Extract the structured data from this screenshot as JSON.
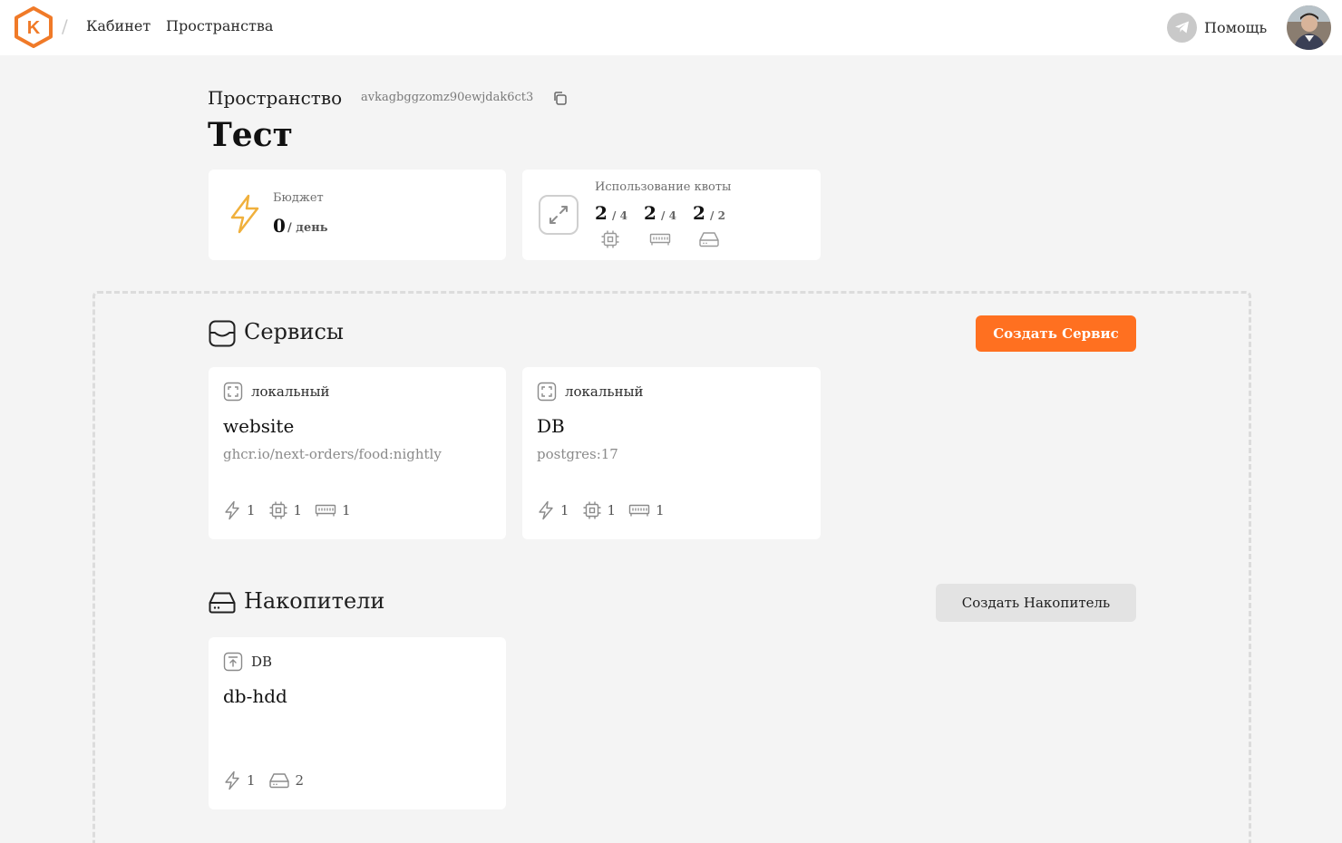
{
  "topbar": {
    "logo_icon": "kubik-hexagon-logo",
    "logo_letter": "K",
    "separator": "/",
    "breadcrumbs": [
      "Кабинет",
      "Пространства"
    ],
    "help_label": "Помощь",
    "help_icon": "telegram-icon"
  },
  "header": {
    "space_label": "Пространство",
    "space_id": "avkagbggzomz90ewjdak6ct3",
    "title": "Тест"
  },
  "budget": {
    "label": "Бюджет",
    "value": "0",
    "unit": "/ день",
    "icon": "lightning-icon"
  },
  "quota": {
    "label": "Использование квоты",
    "items": [
      {
        "used": "2",
        "total": "/ 4",
        "icon": "cpu-icon"
      },
      {
        "used": "2",
        "total": "/ 4",
        "icon": "memory-icon"
      },
      {
        "used": "2",
        "total": "/ 2",
        "icon": "disk-icon"
      }
    ]
  },
  "services": {
    "title": "Сервисы",
    "create_label": "Создать Сервис",
    "items": [
      {
        "tag": "локальный",
        "name": "website",
        "image": "ghcr.io/next-orders/food:nightly",
        "power": "1",
        "cpu": "1",
        "ram": "1"
      },
      {
        "tag": "локальный",
        "name": "DB",
        "image": "postgres:17",
        "power": "1",
        "cpu": "1",
        "ram": "1"
      }
    ]
  },
  "storages": {
    "title": "Накопители",
    "create_label": "Создать Накопитель",
    "items": [
      {
        "tag": "DB",
        "name": "db-hdd",
        "power": "1",
        "disk": "2"
      }
    ]
  },
  "colors": {
    "accent": "#ff7020",
    "budget_icon": "#f0b03c",
    "background": "#f4f4f4"
  }
}
